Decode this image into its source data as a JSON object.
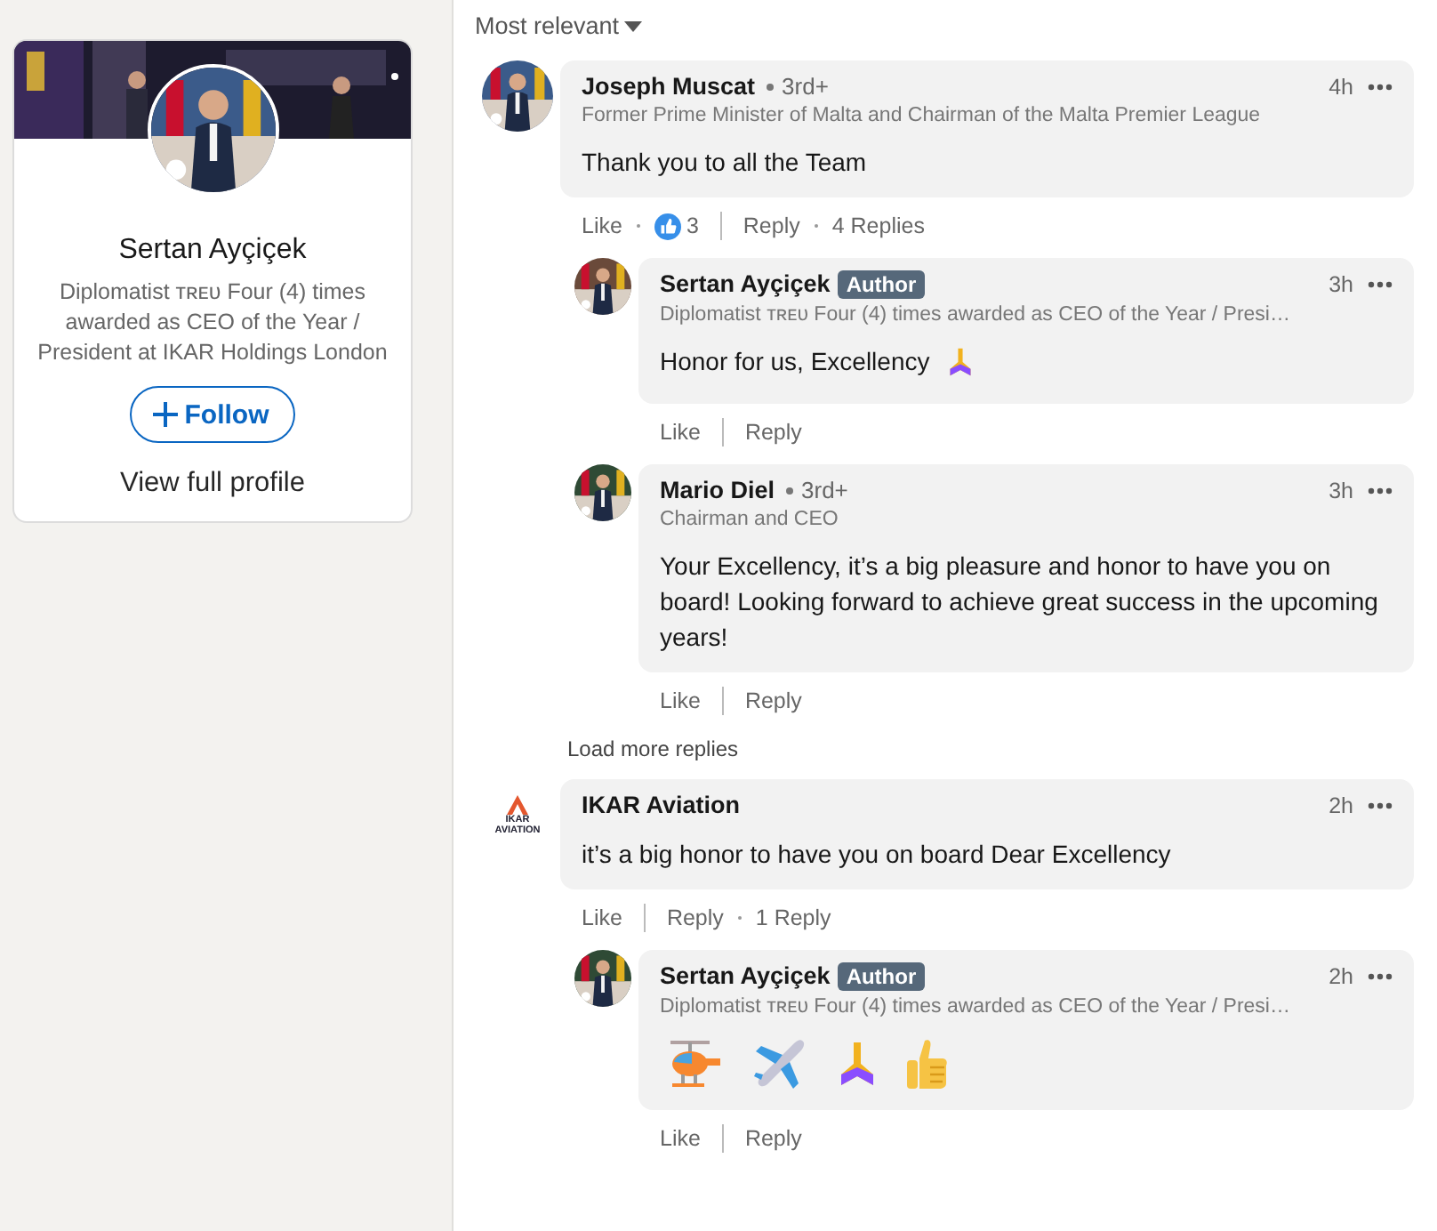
{
  "profile_card": {
    "name": "Sertan Ayçiçek",
    "headline": "Diplomatist ᴛʀᴇᴜ Four (4) times awarded as CEO of the Year / President at IKAR Holdings London",
    "follow_button": "Follow",
    "view_profile": "View full profile"
  },
  "sort": {
    "label": "Most relevant"
  },
  "comments": [
    {
      "avatar": {
        "kind": "picture"
      },
      "author": "Joseph Muscat",
      "degree": "3rd+",
      "headline": "Former Prime Minister of Malta and Chairman of the Malta Premier League",
      "time": "4h",
      "text": "Thank you to all the Team",
      "like": "Like",
      "reactions": "3",
      "reply": "Reply",
      "replies_count": "4 Replies",
      "load_more": "Load more replies",
      "replies": [
        {
          "avatar": {
            "kind": "picture"
          },
          "author": "Sertan Ayçiçek",
          "badge": "Author",
          "headline": "Diplomatist ᴛʀᴇᴜ Four (4) times awarded as CEO of the Year / Presi…",
          "time": "3h",
          "text": "Honor for us, Excellency",
          "emojis": [
            {
              "kind": "folded-hands"
            }
          ],
          "like": "Like",
          "reply": "Reply"
        },
        {
          "avatar": {
            "kind": "picture"
          },
          "author": "Mario Diel",
          "degree": "3rd+",
          "headline": "Chairman and CEO",
          "time": "3h",
          "text": "Your Excellency, it’s a big pleasure and honor to have you on board! Looking forward to achieve great success in the upcoming years!",
          "like": "Like",
          "reply": "Reply"
        }
      ]
    },
    {
      "avatar": {
        "kind": "logo",
        "logo_text": [
          "IKAR",
          "AVIATION"
        ]
      },
      "author": "IKAR Aviation",
      "time": "2h",
      "text": "it’s a big honor to have you on board Dear Excellency",
      "like": "Like",
      "reply": "Reply",
      "replies_count": "1 Reply",
      "replies": [
        {
          "avatar": {
            "kind": "picture"
          },
          "author": "Sertan Ayçiçek",
          "badge": "Author",
          "headline": "Diplomatist ᴛʀᴇᴜ Four (4) times awarded as CEO of the Year / Presi…",
          "time": "2h",
          "emojis": [
            {
              "kind": "helicopter"
            },
            {
              "kind": "airplane"
            },
            {
              "kind": "folded-hands"
            },
            {
              "kind": "thumbs-up"
            }
          ],
          "like": "Like",
          "reply": "Reply"
        }
      ]
    }
  ]
}
